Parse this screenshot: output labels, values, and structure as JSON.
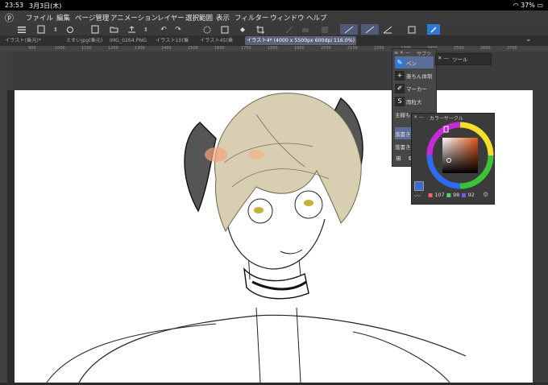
{
  "status": {
    "time": "23:53",
    "date": "3月3日(木)",
    "battery": "37%"
  },
  "menu": [
    "ファイル",
    "編集",
    "ページ管理",
    "アニメーション",
    "レイヤー",
    "選択範囲",
    "表示",
    "フィルター",
    "ウィンドウ",
    "ヘルプ"
  ],
  "tabs": [
    "イラスト(乗元)*",
    "えそいjpg(乗元)",
    "IMG_0264.PNG",
    "イラスト10(乗",
    "イラスト45(乗",
    "イラスト4* (4000 x 5500px 600dpi 116.0%)"
  ],
  "ruler_ticks": [
    "900",
    "1000",
    "1100",
    "1200",
    "1300",
    "1400",
    "1500",
    "1600",
    "1700",
    "1800",
    "1900",
    "2000",
    "2100",
    "2200",
    "2300",
    "2400",
    "2500",
    "2600",
    "2700"
  ],
  "subtool": {
    "title": "サブツ",
    "items": [
      "ペン",
      "楽ちん体制",
      "マーカー",
      "雨粒大",
      "主線もの(一絵",
      "落書き",
      "落書き"
    ]
  },
  "tool_panel": {
    "title": "ツール"
  },
  "color_circle": {
    "title": "カラーサークル",
    "h": "107",
    "s": "98",
    "v": "92",
    "current_color": "#d98a4a"
  },
  "colors": {
    "accent": "#5d6d9a",
    "bg": "#2b2b2b"
  }
}
